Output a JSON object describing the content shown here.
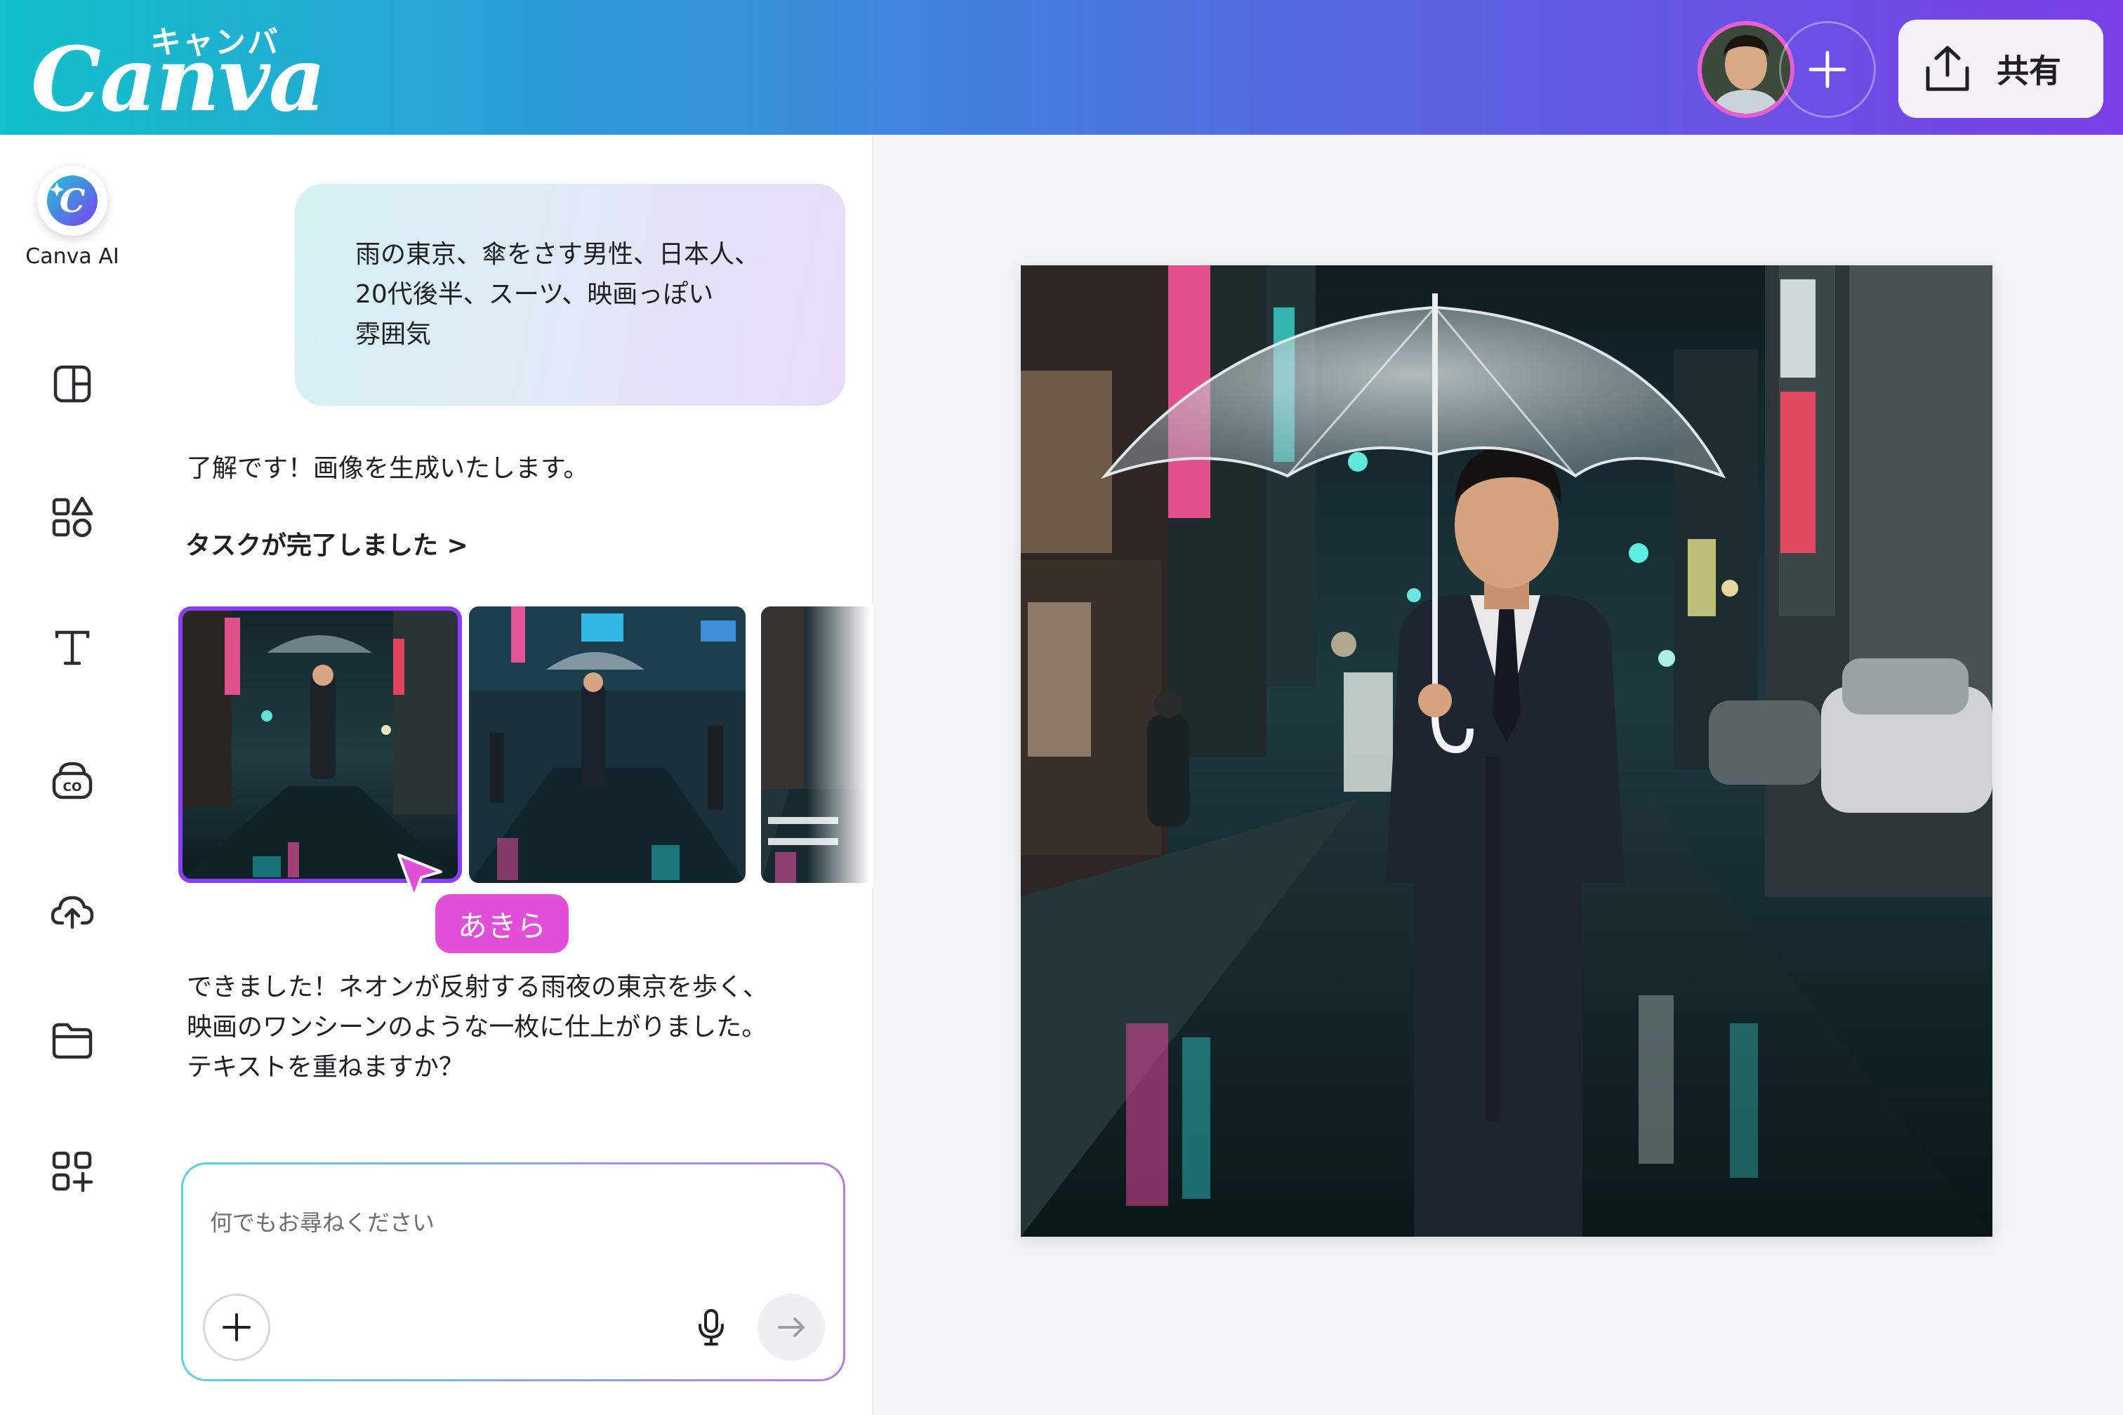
{
  "header": {
    "logo_kana": "キャンバ",
    "logo_text": "Canva",
    "share_label": "共有",
    "icons": {
      "avatar": "user-avatar",
      "add": "plus-icon",
      "share": "share-upload-icon"
    }
  },
  "rail": {
    "ai_label": "Canva AI",
    "items": [
      {
        "icon": "design-layout-icon"
      },
      {
        "icon": "elements-shapes-icon"
      },
      {
        "icon": "text-icon"
      },
      {
        "icon": "brand-icon"
      },
      {
        "icon": "upload-cloud-icon"
      },
      {
        "icon": "projects-folder-icon"
      },
      {
        "icon": "apps-icon"
      }
    ]
  },
  "chat": {
    "user_prompt_lines": [
      "雨の東京、傘をさす男性、日本人、",
      "20代後半、スーツ、映画っぽい",
      "雰囲気"
    ],
    "ai_reply1": "了解です！画像を生成いたします。",
    "task_done": "タスクが完了しました >",
    "cursor_name": "あきら",
    "ai_reply2_lines": [
      "できました！ネオンが反射する雨夜の東京を歩く、",
      "映画のワンシーンのような一枚に仕上がりました。",
      "テキストを重ねますか？"
    ]
  },
  "composer": {
    "placeholder": "何でもお尋ねください",
    "icons": {
      "add": "plus-icon",
      "mic": "microphone-icon",
      "send": "arrow-right-icon"
    }
  },
  "colors": {
    "header_gradient": [
      "#12c1c9",
      "#5568e0",
      "#7a3fe6"
    ],
    "accent_purple": "#8b3dff",
    "cursor_pink": "#e14fd9"
  }
}
